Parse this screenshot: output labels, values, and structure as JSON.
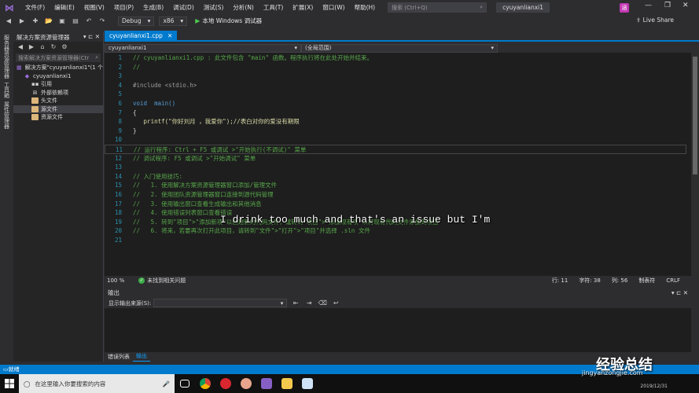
{
  "menubar": {
    "items": [
      "文件(F)",
      "编辑(E)",
      "视图(V)",
      "项目(P)",
      "生成(B)",
      "调试(D)",
      "测试(S)",
      "分析(N)",
      "工具(T)",
      "扩展(X)",
      "窗口(W)",
      "帮助(H)"
    ],
    "search_placeholder": "搜索 (Ctrl+Q)",
    "window_title": "cyuyanlianxi1",
    "user_initial": "涵"
  },
  "toolbar": {
    "config": "Debug",
    "platform": "x86",
    "run_label": "本地 Windows 调试器",
    "live_share": "Live Share"
  },
  "leftstrip": {
    "labels": [
      "服务器资源管理器",
      "工具箱",
      "属性管理器"
    ]
  },
  "solution_explorer": {
    "title": "解决方案资源管理器",
    "search_placeholder": "搜索解决方案资源管理器(Ctr",
    "items": [
      {
        "label": "解决方案\"cyuyanlianxi1\"(1 个",
        "indent": 0,
        "icon": "solution-icon"
      },
      {
        "label": "cyuyanlianxi1",
        "indent": 1,
        "icon": "project-icon"
      },
      {
        "label": "引用",
        "indent": 2,
        "icon": "references-icon"
      },
      {
        "label": "外部依赖项",
        "indent": 2,
        "icon": "dependencies-icon"
      },
      {
        "label": "头文件",
        "indent": 2,
        "icon": "folder-icon"
      },
      {
        "label": "源文件",
        "indent": 2,
        "icon": "folder-icon"
      },
      {
        "label": "资源文件",
        "indent": 2,
        "icon": "folder-icon"
      }
    ]
  },
  "editor": {
    "tab_name": "cyuyanlianxi1.cpp",
    "nav_left": "cyuyanlianxi1",
    "nav_right": "(全局范围)",
    "lines": [
      {
        "n": "1",
        "cls": "c-com",
        "text": "// cyuyanlianxi1.cpp : 此文件包含 \"main\" 函数。程序执行将在此处开始并结束。"
      },
      {
        "n": "2",
        "cls": "c-com",
        "text": "//"
      },
      {
        "n": "3",
        "cls": "c-txt",
        "text": ""
      },
      {
        "n": "4",
        "cls": "c-pre",
        "text": "#include <stdio.h>"
      },
      {
        "n": "5",
        "cls": "c-txt",
        "text": ""
      },
      {
        "n": "6",
        "cls": "c-kw",
        "text": "void  main()"
      },
      {
        "n": "7",
        "cls": "c-txt",
        "text": "{"
      },
      {
        "n": "8",
        "cls": "c-fn",
        "text": "   printf(\"你好刘月 ，我爱你\");//表白对你的爱没有期限"
      },
      {
        "n": "9",
        "cls": "c-txt",
        "text": "}"
      },
      {
        "n": "10",
        "cls": "c-txt",
        "text": ""
      },
      {
        "n": "11",
        "cls": "c-com",
        "text": "// 运行程序: Ctrl + F5 或调试 >\"开始执行(不调试)\" 菜单"
      },
      {
        "n": "12",
        "cls": "c-com",
        "text": "// 调试程序: F5 或调试 >\"开始调试\" 菜单"
      },
      {
        "n": "13",
        "cls": "c-txt",
        "text": ""
      },
      {
        "n": "14",
        "cls": "c-com",
        "text": "// 入门使用技巧:"
      },
      {
        "n": "15",
        "cls": "c-com",
        "text": "//   1. 使用解决方案资源管理器窗口添加/管理文件"
      },
      {
        "n": "16",
        "cls": "c-com",
        "text": "//   2. 使用团队资源管理器窗口连接到源代码管理"
      },
      {
        "n": "17",
        "cls": "c-com",
        "text": "//   3. 使用输出窗口查看生成输出和其他消息"
      },
      {
        "n": "18",
        "cls": "c-com",
        "text": "//   4. 使用错误列表窗口查看错误"
      },
      {
        "n": "19",
        "cls": "c-com",
        "text": "//   5. 转到\"项目\">\"添加新项\"以创建新的代码文件，或转到\"项目\">\"添加现有项\"以将现有代码文件添加到项目"
      },
      {
        "n": "20",
        "cls": "c-com",
        "text": "//   6. 将来，若要再次打开此项目，请转到\"文件\">\"打开\">\"项目\"并选择 .sln 文件"
      },
      {
        "n": "21",
        "cls": "c-txt",
        "text": ""
      }
    ]
  },
  "subtitle": "I drink too much and that's an issue but I'm",
  "editor_status": {
    "zoom": "100 %",
    "issues": "未找到相关问题",
    "line": "行: 11",
    "char": "字符: 38",
    "col": "列: 56",
    "tabs": "制表符",
    "eol": "CRLF"
  },
  "output": {
    "title": "输出",
    "source_label": "显示输出来源(S):",
    "tabs": [
      "错误列表",
      "输出"
    ]
  },
  "statusbar": {
    "text": "就绪"
  },
  "taskbar": {
    "search_placeholder": "在这里输入你要搜索的内容",
    "clock": "2019/12/31"
  },
  "watermark": {
    "text": "经验总结",
    "url": "jingyanzongjie.com"
  }
}
